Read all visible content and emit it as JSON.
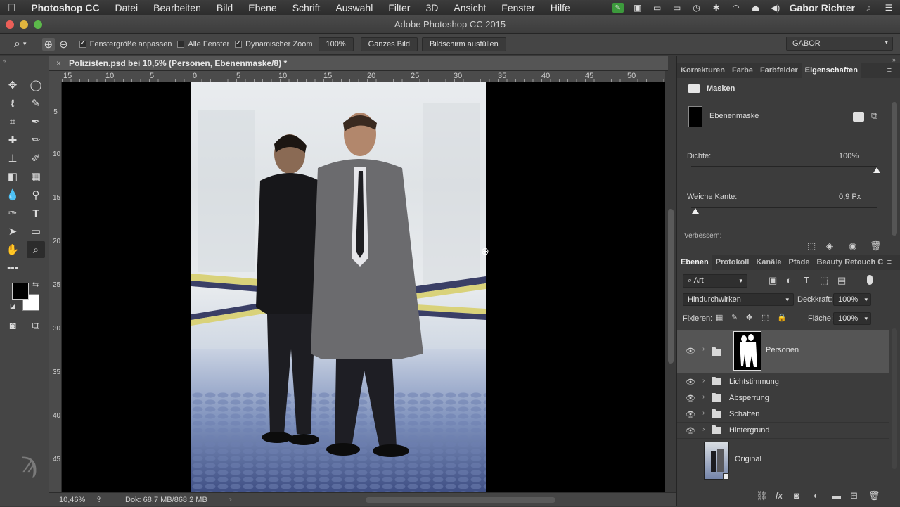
{
  "menubar": {
    "apple": "",
    "app": "Photoshop CC",
    "items": [
      "Datei",
      "Bearbeiten",
      "Bild",
      "Ebene",
      "Schrift",
      "Auswahl",
      "Filter",
      "3D",
      "Ansicht",
      "Fenster",
      "Hilfe"
    ],
    "user": "Gabor Richter"
  },
  "window": {
    "title": "Adobe Photoshop CC 2015"
  },
  "options": {
    "fit_window_label": "Fenstergröße anpassen",
    "all_windows_label": "Alle Fenster",
    "dynamic_zoom_label": "Dynamischer Zoom",
    "zoom_value": "100%",
    "whole_image_btn": "Ganzes Bild",
    "fill_screen_btn": "Bildschirm ausfüllen",
    "workspace": "GABOR"
  },
  "document": {
    "tab_title": "Polizisten.psd bei 10,5% (Personen, Ebenenmaske/8) *",
    "ruler_h": [
      "15",
      "10",
      "5",
      "0",
      "5",
      "10",
      "15",
      "20",
      "25",
      "30",
      "35",
      "40",
      "45",
      "50"
    ],
    "ruler_v": [
      "5",
      "10",
      "15",
      "20",
      "25",
      "30",
      "35",
      "40",
      "45"
    ]
  },
  "status": {
    "zoom": "10,46%",
    "doc_size": "Dok: 68,7 MB/868,2 MB"
  },
  "properties": {
    "tabs": [
      "Korrekturen",
      "Farbe",
      "Farbfelder",
      "Eigenschaften"
    ],
    "section": "Masken",
    "mask_type": "Ebenenmaske",
    "density_label": "Dichte:",
    "density_value": "100%",
    "density_level": 1.0,
    "feather_label": "Weiche Kante:",
    "feather_value": "0,9 Px",
    "feather_level": 0.0,
    "refine_label": "Verbessern:"
  },
  "layers_panel": {
    "tabs": [
      "Ebenen",
      "Protokoll",
      "Kanäle",
      "Pfade",
      "Beauty Retouch C"
    ],
    "filter": "Art",
    "blend_mode": "Hindurchwirken",
    "opacity_label": "Deckkraft:",
    "opacity_value": "100%",
    "lock_label": "Fixieren:",
    "fill_label": "Fläche:",
    "fill_value": "100%",
    "layers": [
      {
        "name": "Personen"
      },
      {
        "name": "Lichtstimmung"
      },
      {
        "name": "Absperrung"
      },
      {
        "name": "Schatten"
      },
      {
        "name": "Hintergrund"
      },
      {
        "name": "Original"
      }
    ]
  }
}
